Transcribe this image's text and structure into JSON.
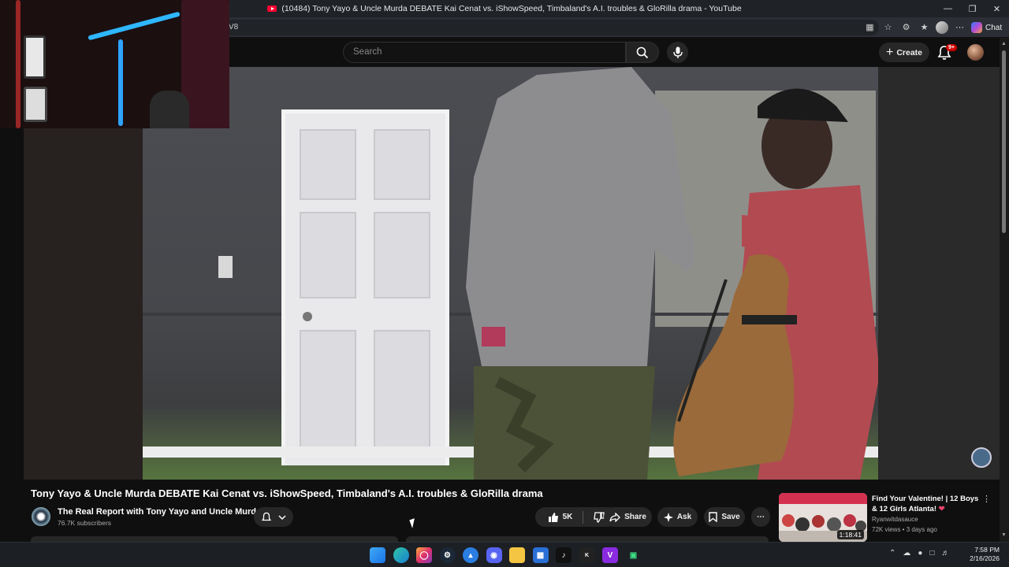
{
  "browser": {
    "tab_title": "(10484) Tony Yayo & Uncle Murda DEBATE Kai Cenat vs. iShowSpeed, Timbaland's A.I. troubles & GloRilla drama - YouTube",
    "address_fragment": "V8",
    "chat_label": "Chat",
    "window_controls": [
      "minimize-icon",
      "restore-icon",
      "close-icon"
    ]
  },
  "header": {
    "search_placeholder": "Search",
    "create_label": "Create",
    "notification_badge": "9+"
  },
  "video": {
    "title": "Tony Yayo & Uncle Murda DEBATE Kai Cenat vs. iShowSpeed, Timbaland's A.I. troubles & GloRilla drama",
    "channel_name": "The Real Report with Tony Yayo and Uncle Murda",
    "subscribers": "76.7K subscribers",
    "likes": "5K",
    "share_label": "Share",
    "ask_label": "Ask",
    "save_label": "Save"
  },
  "recommendation": {
    "title": "Find Your Valentine! | 12 Boys & 12 Girls Atlanta!",
    "channel": "Ryanwitdasauce",
    "meta": "72K views • 3 days ago",
    "duration": "1:18:41"
  },
  "taskbar": {
    "apps": [
      "windows-start-icon",
      "edge-icon",
      "instagram-icon",
      "steam-icon",
      "app-icon",
      "discord-icon",
      "file-explorer-icon",
      "store-icon",
      "tiktok-icon",
      "kick-icon",
      "vimeo-icon",
      "android-icon"
    ],
    "time": "7:58 PM",
    "date": "2/16/2026"
  },
  "colors": {
    "background": "#0f0f0f",
    "chip": "#272727",
    "brand_red": "#ff0033"
  }
}
